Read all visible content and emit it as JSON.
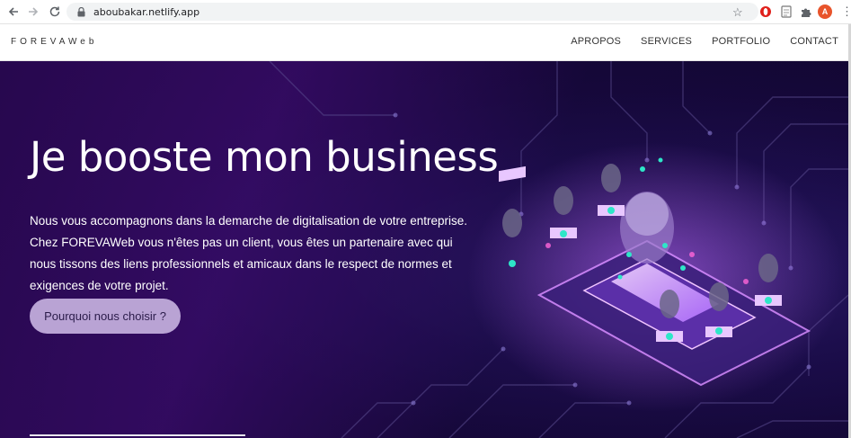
{
  "browser": {
    "url": "aboubakar.netlify.app",
    "avatar_letter": "A",
    "accent": "#e8542b"
  },
  "site": {
    "logo": "FOREVAWeb",
    "menu": [
      {
        "label": "APROPOS"
      },
      {
        "label": "SERVICES"
      },
      {
        "label": "PORTFOLIO"
      },
      {
        "label": "CONTACT"
      }
    ]
  },
  "hero": {
    "headline": "Je booste mon business",
    "paragraph": "Nous vous accompagnons dans la demarche de digitalisation de votre entreprise. Chez FOREVAWeb vous n'êtes pas un client, vous êtes un partenaire avec qui nous tissons des liens professionnels et amicaux dans le respect de normes et exigences de votre projet.",
    "cta_label": "Pourquoi nous choisir ?",
    "cta_color": "#b9a3d4",
    "background_color": "#1b0d4a"
  }
}
